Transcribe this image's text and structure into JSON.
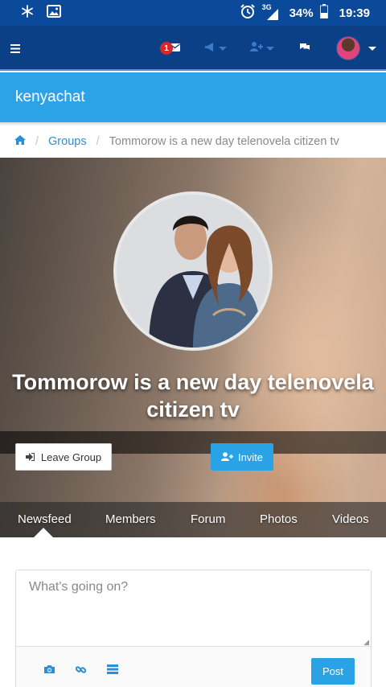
{
  "status_bar": {
    "icons": [
      "snowflake-icon",
      "gallery-icon",
      "alarm-icon",
      "network-icon",
      "battery-icon"
    ],
    "network": "3G",
    "battery": "34%",
    "time": "19:39"
  },
  "navbar": {
    "message_badge": "1",
    "icons": [
      "menu-icon",
      "envelope-icon",
      "bullhorn-icon",
      "add-user-icon",
      "chat-icon"
    ]
  },
  "site": {
    "title": "kenyachat"
  },
  "breadcrumb": {
    "home_icon": "home-icon",
    "groups": "Groups",
    "current": "Tommorow is a new day telenovela citizen tv"
  },
  "group": {
    "name": "Tommorow is a new day telenovela citizen tv",
    "leave_label": "Leave Group",
    "invite_label": "Invite"
  },
  "tabs": [
    "Newsfeed",
    "Members",
    "Forum",
    "Photos",
    "Videos"
  ],
  "active_tab": "Newsfeed",
  "composer": {
    "placeholder": "What's going on?",
    "post_label": "Post",
    "tools": [
      "camera-icon",
      "link-icon",
      "list-icon"
    ]
  },
  "colors": {
    "status_bar": "#0b4a9a",
    "navbar": "#0b3f86",
    "brand_blue": "#2ba3e6",
    "badge_red": "#d9262b"
  }
}
